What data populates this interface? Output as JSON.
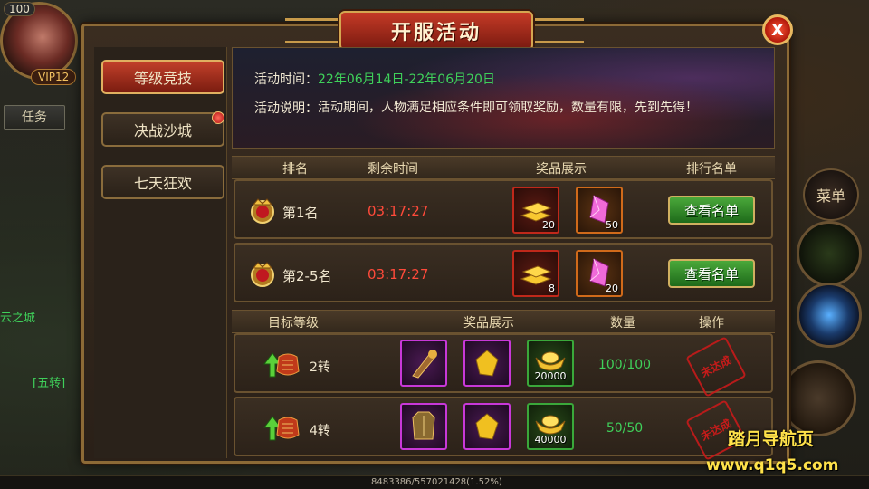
{
  "hud": {
    "player_level": "100",
    "vip": "VIP12",
    "task_tab": "任务",
    "side_city": "云之城",
    "side_hint": "[五转]",
    "menu_label": "菜单",
    "xp_text": "8483386/557021428(1.52%)"
  },
  "dialog": {
    "title": "开服活动",
    "close_label": "X"
  },
  "nav": {
    "items": [
      {
        "label": "等级竞技",
        "active": true
      },
      {
        "label": "决战沙城",
        "active": false
      },
      {
        "label": "七天狂欢",
        "active": false
      }
    ]
  },
  "info": {
    "time_label": "活动时间：",
    "time_value": "22年06月14日-22年06月20日",
    "desc_label": "活动说明：",
    "desc_value": "活动期间，人物满足相应条件即可领取奖励，数量有限，先到先得！"
  },
  "rank_table": {
    "headers": [
      "排名",
      "剩余时间",
      "奖品展示",
      "排行名单"
    ],
    "rows": [
      {
        "rank": "第1名",
        "time": "03:17:27",
        "rewards": [
          {
            "type": "gold-bars",
            "count": "20"
          },
          {
            "type": "crystal",
            "count": "50"
          }
        ],
        "button": "查看名单"
      },
      {
        "rank": "第2-5名",
        "time": "03:17:27",
        "rewards": [
          {
            "type": "gold-bars",
            "count": "8"
          },
          {
            "type": "crystal",
            "count": "20"
          }
        ],
        "button": "查看名单"
      }
    ]
  },
  "level_table": {
    "headers": [
      "目标等级",
      "奖品展示",
      "数量",
      "操作"
    ],
    "rows": [
      {
        "level": "2转",
        "rewards": [
          {
            "type": "gauntlet",
            "count": ""
          },
          {
            "type": "gem",
            "count": ""
          },
          {
            "type": "ingot",
            "count": "20000"
          }
        ],
        "qty": "100/100",
        "stamp": "未达成"
      },
      {
        "level": "4转",
        "rewards": [
          {
            "type": "armor",
            "count": ""
          },
          {
            "type": "gem",
            "count": ""
          },
          {
            "type": "ingot",
            "count": "40000"
          }
        ],
        "qty": "50/50",
        "stamp": "未达成"
      }
    ]
  },
  "watermark": {
    "line1": "踏月导航页",
    "line2": "www.q1q5.com"
  }
}
